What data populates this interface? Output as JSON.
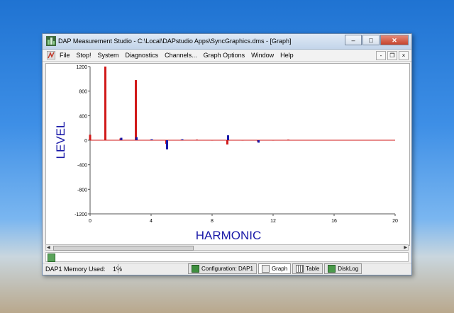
{
  "window": {
    "title": "DAP Measurement Studio - C:\\Local\\DAPstudio Apps\\SyncGraphics.dms - [Graph]",
    "buttons": [
      "–",
      "□",
      "✕"
    ]
  },
  "menu": {
    "items": [
      "File",
      "Stop!",
      "System",
      "Diagnostics",
      "Channels...",
      "Graph Options",
      "Window",
      "Help"
    ],
    "mdi_buttons": [
      "-",
      "❐",
      "×"
    ]
  },
  "chart_data": {
    "type": "bar",
    "xlabel": "HARMONIC",
    "ylabel": "LEVEL",
    "xlim": [
      0,
      20
    ],
    "ylim": [
      -1200,
      1200
    ],
    "xticks": [
      0,
      4,
      8,
      12,
      16,
      20
    ],
    "yticks": [
      1200,
      800,
      400,
      0,
      -400,
      -800,
      -1200
    ],
    "series": [
      {
        "color": "#d11a1a",
        "points": [
          {
            "x": 0,
            "y": 90
          },
          {
            "x": 1,
            "y": 1200
          },
          {
            "x": 2,
            "y": 30
          },
          {
            "x": 3,
            "y": 980
          },
          {
            "x": 4,
            "y": 10
          },
          {
            "x": 5,
            "y": -60
          },
          {
            "x": 6,
            "y": 10
          },
          {
            "x": 7,
            "y": 10
          },
          {
            "x": 8,
            "y": 5
          },
          {
            "x": 9,
            "y": -70
          },
          {
            "x": 10,
            "y": 5
          },
          {
            "x": 11,
            "y": -20
          },
          {
            "x": 12,
            "y": 5
          },
          {
            "x": 13,
            "y": 10
          }
        ]
      },
      {
        "color": "#1a1aa8",
        "points": [
          {
            "x": 2,
            "y": 40
          },
          {
            "x": 3,
            "y": 50
          },
          {
            "x": 4,
            "y": 15
          },
          {
            "x": 5,
            "y": -150
          },
          {
            "x": 6,
            "y": 15
          },
          {
            "x": 9,
            "y": 80
          },
          {
            "x": 11,
            "y": -40
          }
        ]
      }
    ]
  },
  "status": {
    "memory_label": "DAP1 Memory Used:",
    "memory_value": "1%"
  },
  "tabs": [
    {
      "label": "Configuration: DAP1",
      "icon": "configuration-icon",
      "active": false
    },
    {
      "label": "Graph",
      "icon": "graph-icon",
      "active": true
    },
    {
      "label": "Table",
      "icon": "table-icon",
      "active": false
    },
    {
      "label": "DiskLog",
      "icon": "disklog-icon",
      "active": false
    }
  ],
  "colors": {
    "titlebar": "#c3d5ea",
    "series_red": "#d11a1a",
    "series_blue": "#1a1aa8",
    "axis_label": "#1a1aa8"
  }
}
